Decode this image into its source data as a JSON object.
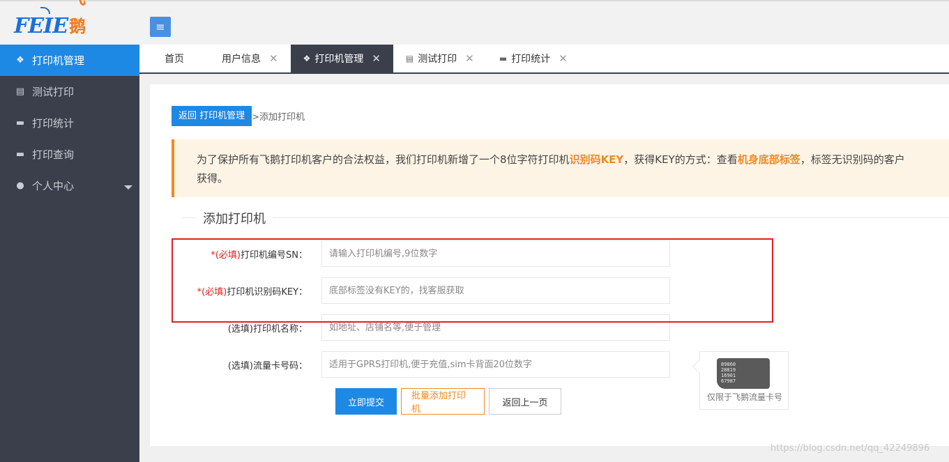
{
  "logo": {
    "latin": "FEIE",
    "cn": "飞鹅"
  },
  "sidebar": {
    "items": [
      {
        "label": "打印机管理",
        "icon": "cubes-icon"
      },
      {
        "label": "测试打印",
        "icon": "document-icon"
      },
      {
        "label": "打印统计",
        "icon": "monitor-icon"
      },
      {
        "label": "打印查询",
        "icon": "monitor-icon"
      },
      {
        "label": "个人中心",
        "icon": "user-icon"
      }
    ]
  },
  "tabs": [
    {
      "label": "首页"
    },
    {
      "label": "用户信息"
    },
    {
      "label": "打印机管理"
    },
    {
      "label": "测试打印"
    },
    {
      "label": "打印统计"
    }
  ],
  "breadcrumb": {
    "back": "返回 打印机管理",
    "current": ">添加打印机"
  },
  "notice": {
    "p1": "为了保护所有飞鹅打印机客户的合法权益，我们打印机新增了一个8位字符打印机",
    "b1": "识别码KEY",
    "p2": "，获得KEY的方式：查看",
    "b2": "机身底部标签",
    "p3": "，标签无识别码的客户",
    "p4": "获得。"
  },
  "form": {
    "legend": "添加打印机",
    "sn": {
      "req": "*(必填)",
      "label": "打印机编号SN：",
      "placeholder": "请输入打印机编号,9位数字"
    },
    "key": {
      "req": "*(必填)",
      "label": "打印机识别码KEY：",
      "placeholder": "底部标签没有KEY的，找客服获取"
    },
    "name": {
      "label": "(选填)打印机名称：",
      "placeholder": "如地址、店铺名等,便于管理"
    },
    "card": {
      "label": "(选填)流量卡号码：",
      "placeholder": "适用于GPRS打印机,便于充值,sim卡背面20位数字"
    }
  },
  "buttons": {
    "submit": "立即提交",
    "batch": "批量添加打印机",
    "back": "返回上一页"
  },
  "sim_tip": {
    "lines": [
      "89860",
      "28819",
      "16901",
      "67987"
    ],
    "caption": "仅限于飞鹅流量卡号"
  },
  "watermark": "https://blog.csdn.net/qq_42249896"
}
